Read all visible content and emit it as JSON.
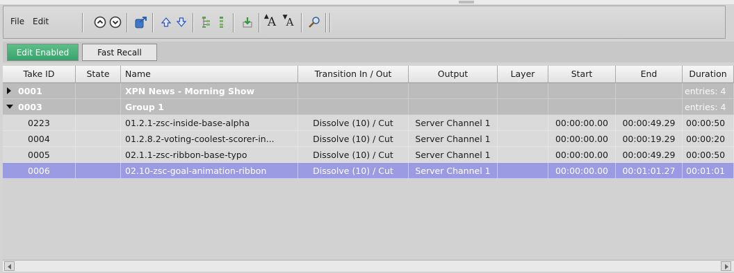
{
  "menu": {
    "file": "File",
    "edit": "Edit"
  },
  "toolbar": {
    "icons": [
      "circle-up-icon",
      "circle-down-icon",
      "export-icon",
      "arrow-up-icon",
      "arrow-down-icon",
      "expand-tree-icon",
      "collapse-tree-icon",
      "import-icon",
      "font-increase-icon",
      "font-decrease-icon",
      "search-icon"
    ],
    "font_large": "A",
    "font_small": "A"
  },
  "tabs": {
    "edit_enabled": "Edit Enabled",
    "fast_recall": "Fast Recall"
  },
  "columns": [
    "Take ID",
    "State",
    "Name",
    "Transition In / Out",
    "Output",
    "Layer",
    "Start",
    "End",
    "Duration"
  ],
  "groups": [
    {
      "id": "0001",
      "name": "XPN News - Morning Show",
      "entries": "entries: 4",
      "expanded": false
    },
    {
      "id": "0003",
      "name": "Group 1",
      "entries": "entries: 4",
      "expanded": true
    }
  ],
  "rows": [
    {
      "id": "0223",
      "state": "",
      "name": "01.2.1-zsc-inside-base-alpha",
      "transition": "Dissolve (10) / Cut",
      "output": "Server Channel 1",
      "layer": "",
      "start": "00:00:00.00",
      "end": "00:00:49.29",
      "duration": "00:00:50"
    },
    {
      "id": "0004",
      "state": "",
      "name": "01.2.8.2-voting-coolest-scorer-in...",
      "transition": "Dissolve (10) / Cut",
      "output": "Server Channel 1",
      "layer": "",
      "start": "00:00:00.00",
      "end": "00:00:19.29",
      "duration": "00:00:20"
    },
    {
      "id": "0005",
      "state": "",
      "name": "02.1.1-zsc-ribbon-base-typo",
      "transition": "Dissolve (10) / Cut",
      "output": "Server Channel 1",
      "layer": "",
      "start": "00:00:00.00",
      "end": "00:00:49.29",
      "duration": "00:00:50"
    },
    {
      "id": "0006",
      "state": "",
      "name": "02.10-zsc-goal-animation-ribbon",
      "transition": "Dissolve (10) / Cut",
      "output": "Server Channel 1",
      "layer": "",
      "start": "00:00:00.00",
      "end": "00:01:01.27",
      "duration": "00:01:01",
      "selected": true
    }
  ],
  "colors": {
    "accent_green": "#3fa873",
    "selection": "#9b9be4",
    "group_row": "#bcbcbc"
  }
}
